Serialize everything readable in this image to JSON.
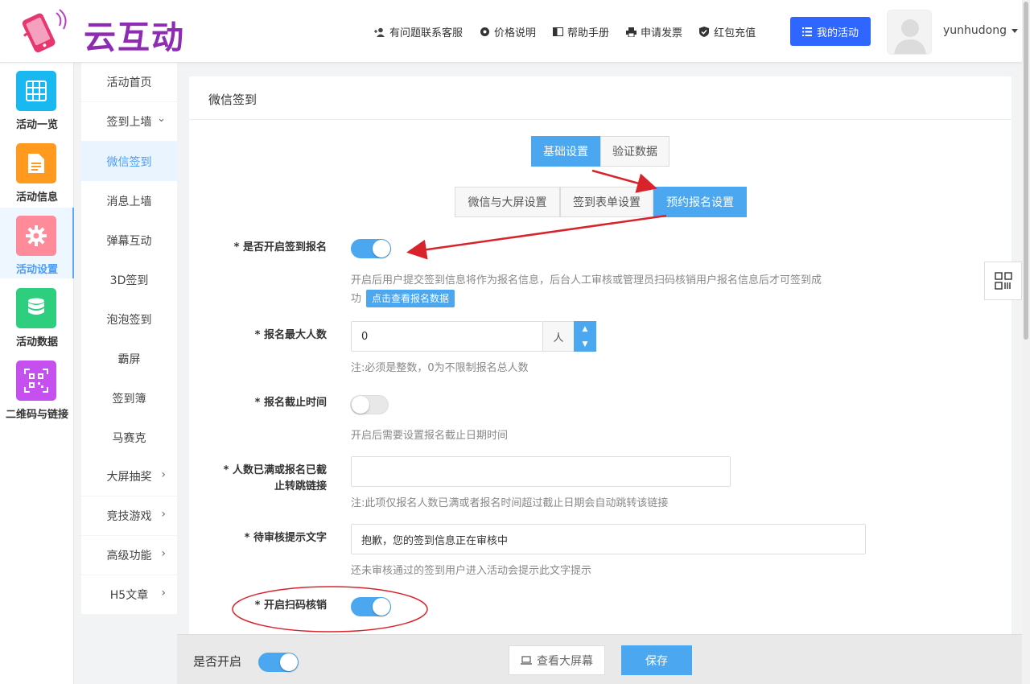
{
  "header": {
    "logo_text": "云互动",
    "nav": [
      {
        "label": "有问题联系客服",
        "icon": "user-plus-icon"
      },
      {
        "label": "价格说明",
        "icon": "gear-icon"
      },
      {
        "label": "帮助手册",
        "icon": "book-icon"
      },
      {
        "label": "申请发票",
        "icon": "printer-icon"
      },
      {
        "label": "红包充值",
        "icon": "shield-check-icon"
      }
    ],
    "my_activity": "我的活动",
    "username": "yunhudong"
  },
  "icon_sidebar": [
    {
      "label": "活动一览",
      "icon": "grid-icon",
      "color": "#19b8f0"
    },
    {
      "label": "活动信息",
      "icon": "document-icon",
      "color": "#ff9a1f"
    },
    {
      "label": "活动设置",
      "icon": "gear-icon",
      "color": "#ff8a9a"
    },
    {
      "label": "活动数据",
      "icon": "database-icon",
      "color": "#2dcf7e"
    },
    {
      "label": "二维码与链接",
      "icon": "qrcode-icon",
      "color": "#c64ff0"
    }
  ],
  "sub_menu": [
    {
      "label": "活动首页",
      "arrow": ""
    },
    {
      "label": "签到上墙",
      "arrow": "⌄"
    },
    {
      "label": "微信签到",
      "arrow": ""
    },
    {
      "label": "消息上墙",
      "arrow": ""
    },
    {
      "label": "弹幕互动",
      "arrow": ""
    },
    {
      "label": "3D签到",
      "arrow": ""
    },
    {
      "label": "泡泡签到",
      "arrow": ""
    },
    {
      "label": "霸屏",
      "arrow": ""
    },
    {
      "label": "签到簿",
      "arrow": ""
    },
    {
      "label": "马赛克",
      "arrow": ""
    },
    {
      "label": "大屏抽奖",
      "arrow": "›"
    },
    {
      "label": "竞技游戏",
      "arrow": "›"
    },
    {
      "label": "高级功能",
      "arrow": "›"
    },
    {
      "label": "H5文章",
      "arrow": "›"
    }
  ],
  "panel": {
    "title": "微信签到",
    "tabs_top": [
      "基础设置",
      "验证数据"
    ],
    "tabs_sub": [
      "微信与大屏设置",
      "签到表单设置",
      "预约报名设置"
    ]
  },
  "form": {
    "enable_signup": {
      "label": "* 是否开启签到报名",
      "on": true
    },
    "enable_hint_1": "开启后用户提交签到信息将作为报名信息，后台人工审核或管理员扫码核销用户报名信息后才可签到成",
    "enable_hint_2": "功",
    "view_data_btn": "点击查看报名数据",
    "max_count": {
      "label": "* 报名最大人数",
      "value": "0",
      "unit": "人"
    },
    "max_hint": "注:必须是整数，0为不限制报名总人数",
    "deadline": {
      "label": "* 报名截止时间",
      "on": false
    },
    "deadline_hint": "开启后需要设置报名截止日期时间",
    "redirect": {
      "label_1": "* 人数已满或报名已截",
      "label_2": "止转跳链接",
      "value": ""
    },
    "redirect_hint": "注:此项仅报名人数已满或者报名时间超过截止日期会自动跳转该链接",
    "pending": {
      "label": "* 待审核提示文字",
      "value": "抱歉，您的签到信息正在审核中"
    },
    "pending_hint": "还未审核通过的签到用户进入活动会提示此文字提示",
    "scan": {
      "label": "* 开启扫码核销",
      "on": true
    }
  },
  "footer": {
    "enable_label": "是否开启",
    "view_btn": "查看大屏幕",
    "save_btn": "保存"
  },
  "colors": {
    "accent": "#4aa7f0",
    "primary": "#2f66ff",
    "annotation": "#d9232b"
  }
}
